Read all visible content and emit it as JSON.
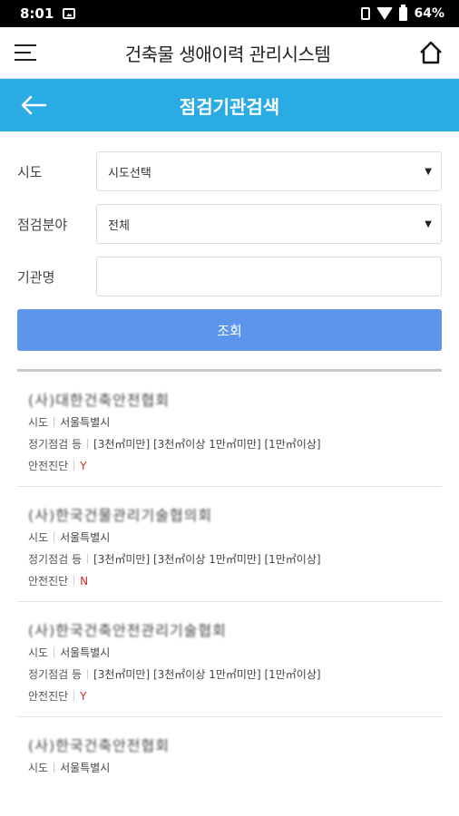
{
  "status": {
    "time": "8:01",
    "battery": "64%"
  },
  "appbar": {
    "title": "건축물 생애이력 관리시스템"
  },
  "subbar": {
    "title": "점검기관검색"
  },
  "form": {
    "sido_label": "시도",
    "sido_value": "시도선택",
    "field_label": "점검분야",
    "field_value": "전체",
    "org_label": "기관명",
    "org_placeholder": "",
    "search_button": "조회"
  },
  "results": [
    {
      "name": "(사)대한건축안전협회",
      "sido_key": "시도",
      "sido": "서울특별시",
      "inspect_key": "정기점검 등",
      "inspect": "[3천㎡미만] [3천㎡이상 1만㎡미만] [1만㎡이상]",
      "safety_key": "안전진단",
      "safety": "Y"
    },
    {
      "name": "(사)한국건물관리기술협의회",
      "sido_key": "시도",
      "sido": "서울특별시",
      "inspect_key": "정기점검 등",
      "inspect": "[3천㎡미만] [3천㎡이상 1만㎡미만] [1만㎡이상]",
      "safety_key": "안전진단",
      "safety": "N"
    },
    {
      "name": "(사)한국건축안전관리기술협회",
      "sido_key": "시도",
      "sido": "서울특별시",
      "inspect_key": "정기점검 등",
      "inspect": "[3천㎡미만] [3천㎡이상 1만㎡미만] [1만㎡이상]",
      "safety_key": "안전진단",
      "safety": "Y"
    },
    {
      "name": "(사)한국건축안전협회",
      "sido_key": "시도",
      "sido": "서울특별시"
    }
  ]
}
